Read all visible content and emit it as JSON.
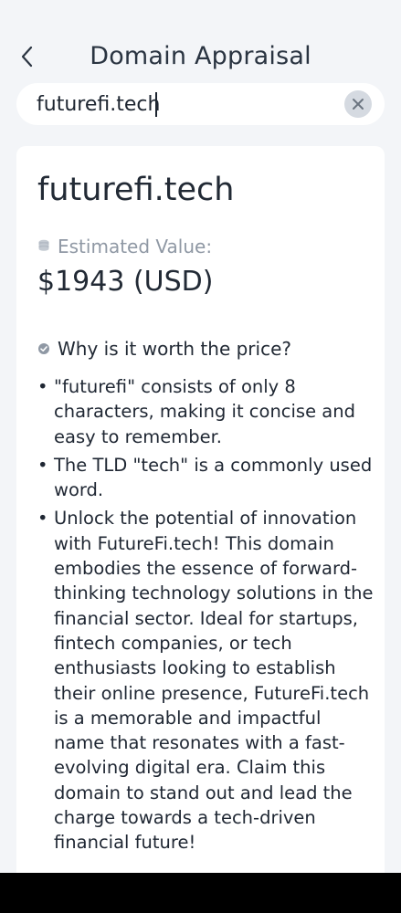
{
  "header": {
    "title": "Domain Appraisal",
    "back_icon": "chevron-left-icon"
  },
  "search": {
    "value": "futurefi.tech",
    "clear_icon": "close-icon"
  },
  "result": {
    "domain": "futurefi.tech",
    "estimated_label": "Estimated Value:",
    "estimated_value": "$1943 (USD)",
    "why_label": "Why is it worth the price?",
    "reasons": [
      "\"futurefi\" consists of only 8 characters, making it concise and easy to remember.",
      "The TLD \"tech\" is a commonly used word.",
      "Unlock the potential of innovation with FutureFi.tech! This domain embodies the essence of forward-thinking technology solutions in the financial sector. Ideal for startups, fintech companies, or tech enthusiasts looking to establish their online presence, FutureFi.tech is a memorable and impactful name that resonates with a fast-evolving digital era. Claim this domain to stand out and lead the charge towards a tech-driven financial future!"
    ]
  },
  "colors": {
    "background": "#f3f5f8",
    "card": "#ffffff",
    "muted_text": "#8f98a4",
    "clear_button": "#d5dae1"
  }
}
